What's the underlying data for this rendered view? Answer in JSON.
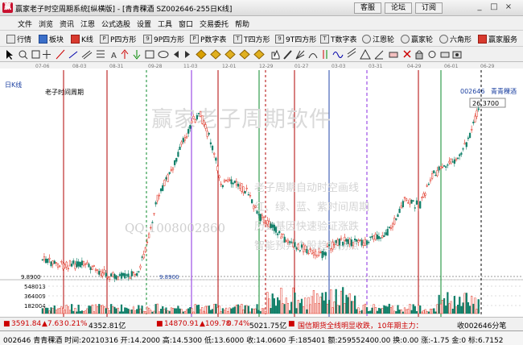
{
  "window": {
    "title": "赢家老子时空周期系统[纵横版] - [青青稞酒 SZ002646-255日K线]",
    "buttons": [
      "客服",
      "论坛",
      "订阅"
    ],
    "controls": [
      "_",
      "□",
      "×"
    ]
  },
  "menu": [
    "文件",
    "浏览",
    "资讯",
    "江恩",
    "公式选股",
    "设置",
    "工具",
    "窗口",
    "交易委托",
    "帮助"
  ],
  "toolbar": [
    {
      "label": "行情",
      "icon": "grid-icon"
    },
    {
      "label": "板块",
      "icon": "sector-icon"
    },
    {
      "label": "K线",
      "icon": "kline-icon"
    },
    {
      "label": "P四方形",
      "icon": "square-icon"
    },
    {
      "label": "9P四方形",
      "icon": "square-icon"
    },
    {
      "label": "P数字表",
      "icon": "table-icon"
    },
    {
      "label": "T四方形",
      "icon": "square-icon"
    },
    {
      "label": "9T四方形",
      "icon": "square-icon"
    },
    {
      "label": "T数字表",
      "icon": "table-icon"
    },
    {
      "label": "江恩轮",
      "icon": "wheel-icon"
    },
    {
      "label": "赢家轮",
      "icon": "wheel-icon"
    },
    {
      "label": "六角形",
      "icon": "hexagon-icon"
    },
    {
      "label": "赢家服务",
      "icon": "service-icon"
    }
  ],
  "chart": {
    "period_label": "日K线",
    "indicator_label": "老子时间周期",
    "stock_code": "002646",
    "stock_name": "青青稞酒",
    "dates": [
      "07-06",
      "08-03",
      "08-31",
      "09-28",
      "11-03",
      "12-01",
      "12-29",
      "01-27",
      "03-03",
      "03-31",
      "04-29",
      "06-01",
      "06-29"
    ],
    "current_price": "26.3700",
    "low_price": "9.8900",
    "low_mark": "9.8900",
    "volume_ticks": [
      "548013",
      "364009",
      "182004"
    ],
    "watermark_title": "赢家老子周期软件",
    "watermark_qq": "QQ:1008002860",
    "watermark_lines": [
      "老子周期自动时空画线",
      "红、绿、蓝、紫时间周期",
      "历史基因快速验证涨跌",
      "智能预判个股趋势拐点"
    ]
  },
  "status_bar": {
    "sh_index": "3591.84",
    "sh_change": "▲7.63",
    "sh_pct": "0.21%",
    "sh_amount": "4352.81亿",
    "sz_index": "14870.91",
    "sz_change": "▲109.78",
    "sz_pct": "0.74%",
    "sz_amount": "5021.75亿",
    "news": "国信期货全线明显收跌，10年期主力：",
    "watch": "收002646分笔"
  },
  "bottom_bar": {
    "text": "002646 青青稞酒 时间:20210316 开:14.2000 高:14.5300 低:13.6000 收:14.0600 手:185401 额:259552400.00 换:0.00 涨:-1.75 金:0 标:6.7152"
  },
  "colors": {
    "up": "#e03020",
    "down": "#12806a",
    "red_line": "#b00000",
    "green_line": "#0a8a2a",
    "blue_line": "#2244aa",
    "purple_line": "#8a2be2"
  }
}
